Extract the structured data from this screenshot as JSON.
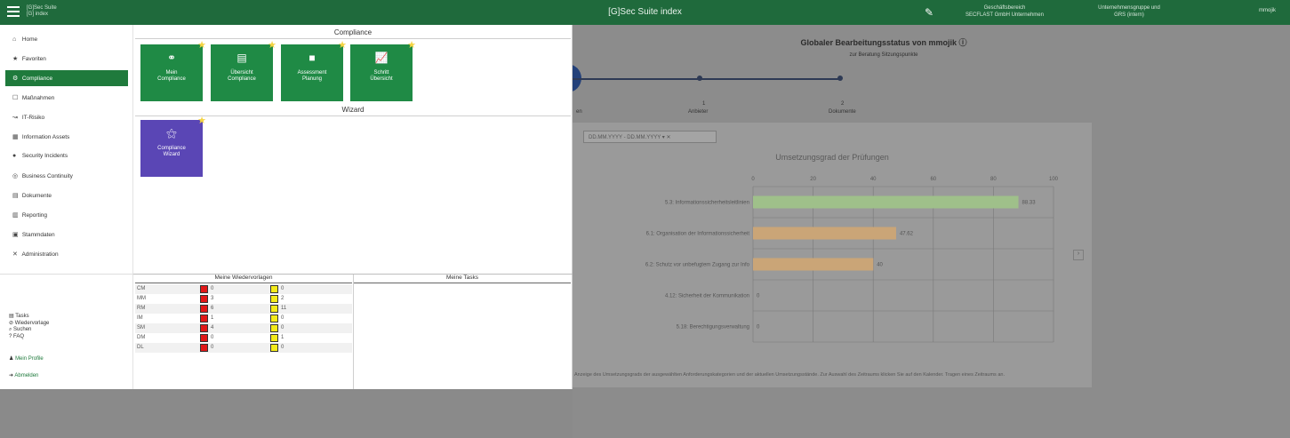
{
  "topbar": {
    "brand_line1": "[G]Sec Suite",
    "brand_line2": "[G] index",
    "title": "[G]Sec Suite index",
    "company_label": "Geschäftsbereich",
    "company_value": "SECFLAST GmbH Unternehmen",
    "unit_label": "Unternehmensgruppe und",
    "unit_value": "GRS (intern)",
    "user": "mmojik"
  },
  "sidebar": {
    "items": [
      {
        "icon": "home-icon",
        "glyph": "⌂",
        "label": "Home"
      },
      {
        "icon": "star-icon",
        "glyph": "★",
        "label": "Favoriten"
      },
      {
        "icon": "compliance-icon",
        "glyph": "⚙",
        "label": "Compliance"
      },
      {
        "icon": "checkbox-icon",
        "glyph": "☐",
        "label": "Maßnahmen"
      },
      {
        "icon": "risk-icon",
        "glyph": "↝",
        "label": "IT-Risiko"
      },
      {
        "icon": "asset-icon",
        "glyph": "▦",
        "label": "Information Assets"
      },
      {
        "icon": "incident-icon",
        "glyph": "●",
        "label": "Security Incidents"
      },
      {
        "icon": "continuity-icon",
        "glyph": "◎",
        "label": "Business Continuity"
      },
      {
        "icon": "documents-icon",
        "glyph": "▤",
        "label": "Dokumente"
      },
      {
        "icon": "reporting-icon",
        "glyph": "▥",
        "label": "Reporting"
      },
      {
        "icon": "master-data-icon",
        "glyph": "▣",
        "label": "Stammdaten"
      },
      {
        "icon": "admin-icon",
        "glyph": "✕",
        "label": "Administration"
      }
    ],
    "links": [
      "Tasks",
      "Wiedervorlage",
      "Suchen",
      "FAQ"
    ],
    "profile": "Mein Profile",
    "logout": "Abmelden"
  },
  "compliance": {
    "title": "Compliance",
    "tiles": [
      {
        "icon": "hierarchy-icon",
        "glyph": "⚭",
        "label1": "Mein",
        "label2": "Compliance"
      },
      {
        "icon": "document-icon",
        "glyph": "▤",
        "label1": "Übersicht",
        "label2": "Compliance"
      },
      {
        "icon": "assessment-icon",
        "glyph": "■",
        "label1": "Assessment",
        "label2": "Planung"
      },
      {
        "icon": "chart-icon",
        "glyph": "📈",
        "label1": "Schritt",
        "label2": "Übersicht"
      }
    ]
  },
  "wizard": {
    "title": "Wizard",
    "tiles": [
      {
        "icon": "magic-wand-icon",
        "glyph": "⚝",
        "label1": "Compliance",
        "label2": "Wizard"
      }
    ]
  },
  "reminders": {
    "title": "Meine Wiedervorlagen",
    "rows": [
      {
        "code": "CM",
        "red": "0",
        "yellow": "0"
      },
      {
        "code": "MM",
        "red": "3",
        "yellow": "2"
      },
      {
        "code": "RM",
        "red": "6",
        "yellow": "11"
      },
      {
        "code": "IM",
        "red": "1",
        "yellow": "0"
      },
      {
        "code": "SM",
        "red": "4",
        "yellow": "0"
      },
      {
        "code": "DM",
        "red": "0",
        "yellow": "1"
      },
      {
        "code": "DL",
        "red": "0",
        "yellow": "0"
      }
    ]
  },
  "tasks": {
    "title": "Meine Tasks"
  },
  "background": {
    "heading": "Globaler Bearbeitungsstatus von mmojik",
    "subheading": "zur Beratung Sitzungspunkte",
    "steps": [
      {
        "num": "1",
        "label": "Anbieter"
      },
      {
        "num": "2",
        "label": "Dokumente"
      }
    ],
    "left_fragment": "en",
    "filter": "DD.MM.YYYY - DD.MM.YYYY",
    "footer": "Anzeige des Umsetzungsgrads der ausgewählten Anforderungskategorien und der aktuellen Umsetzungsstände. Zur Auswahl des Zeitraums klicken Sie auf den Kalender. Tragen eines Zeitraums an."
  },
  "chart_data": {
    "type": "bar",
    "orientation": "horizontal",
    "title": "Umsetzungsgrad der Prüfungen",
    "categories": [
      "5.3: Informationssicherheitsleitlinien",
      "6.1: Organisation der Informationssicherheit",
      "6.2: Schutz vor unbefugtem Zugang zur Info",
      "4.12: Sicherheit der Kommunikation",
      "5.18: Berechtigungsverwaltung"
    ],
    "values": [
      88.33,
      47.62,
      40,
      0,
      0
    ],
    "value_labels": [
      "88.33",
      "47.62",
      "40",
      "0",
      "0"
    ],
    "bar_colors": [
      "#9fc08a",
      "#caa577",
      "#caa577",
      "#caa577",
      "#caa577"
    ],
    "xlim": [
      0,
      100
    ],
    "xticks": [
      0,
      20,
      40,
      60,
      80,
      100
    ],
    "grid": true
  }
}
